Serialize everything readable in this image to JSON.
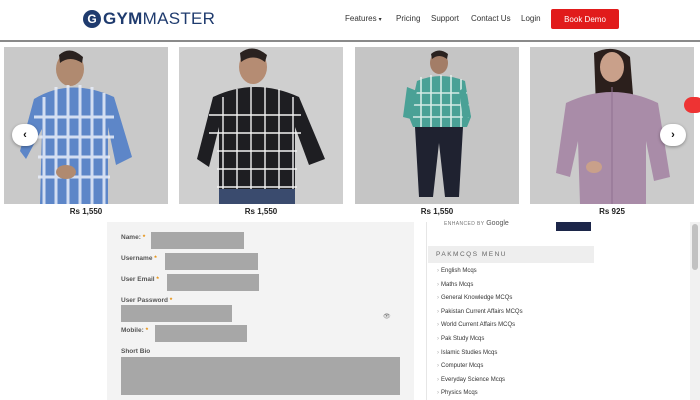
{
  "header": {
    "logo_prefix": "GYM",
    "logo_suffix": "MASTER",
    "logo_mark": "G",
    "nav": [
      {
        "label": "Features",
        "has_caret": true
      },
      {
        "label": "Pricing"
      },
      {
        "label": "Support"
      },
      {
        "label": "Contact Us"
      },
      {
        "label": "Login"
      }
    ],
    "cta_label": "Book Demo",
    "cta_color": "#e11b1b"
  },
  "carousel": {
    "prev_icon": "chevron-left-icon",
    "next_icon": "chevron-right-icon",
    "products": [
      {
        "price": "Rs 1,550",
        "shirt": "blue-check"
      },
      {
        "price": "Rs 1,550",
        "shirt": "black-check"
      },
      {
        "price": "Rs 1,550",
        "shirt": "teal-check"
      },
      {
        "price": "Rs 925",
        "shirt": "mauve-blouse"
      }
    ],
    "prev_glyph": "‹",
    "next_glyph": "›"
  },
  "form": {
    "fields": [
      {
        "label": "Name:",
        "required_mark": "*"
      },
      {
        "label": "Username",
        "required_mark": "*"
      },
      {
        "label": "User Email",
        "required_mark": "*"
      },
      {
        "label": "User Password",
        "required_mark": "*"
      },
      {
        "label": "Mobile:",
        "required_mark": "*"
      },
      {
        "label": "Short Bio",
        "required_mark": ""
      }
    ],
    "password_toggle": "👁"
  },
  "sidebar": {
    "search_badge_text": "ENHANCED BY",
    "search_badge_brand": "Google",
    "menu_title": "PAKMCQS MENU",
    "menu_items": [
      "English Mcqs",
      "Maths Mcqs",
      "General Knowledge MCQs",
      "Pakistan Current Affairs MCQs",
      "World Current Affairs MCQs",
      "Pak Study Mcqs",
      "Islamic Studies Mcqs",
      "Computer Mcqs",
      "Everyday Science Mcqs",
      "Physics Mcqs"
    ]
  }
}
